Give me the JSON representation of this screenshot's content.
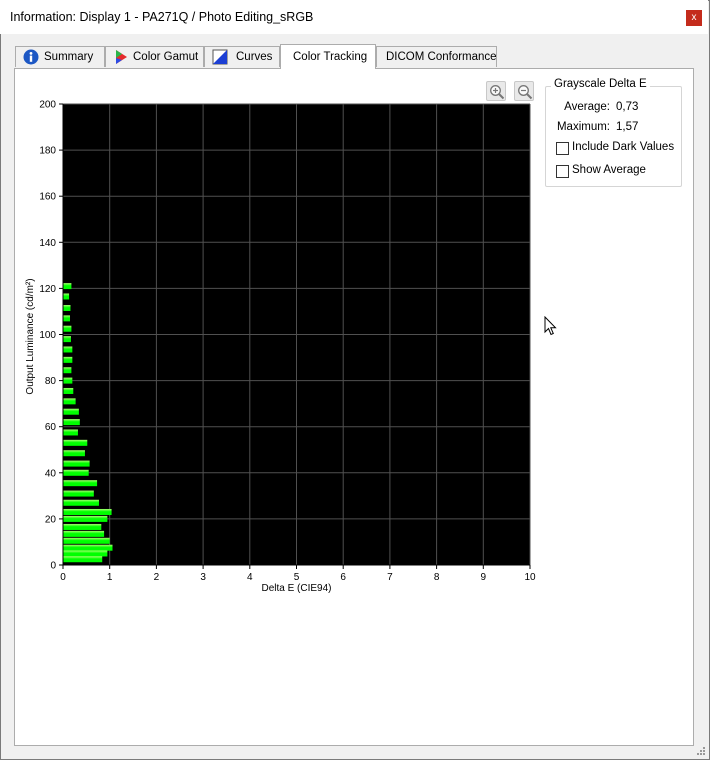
{
  "window": {
    "title": "Information: Display 1 - PA271Q / Photo Editing_sRGB",
    "close_label": "x"
  },
  "tabs": [
    {
      "label": "Summary",
      "icon": "info-icon",
      "active": false
    },
    {
      "label": "Color Gamut",
      "icon": "color-gamut-icon",
      "active": false
    },
    {
      "label": "Curves",
      "icon": "curves-icon",
      "active": false
    },
    {
      "label": "Color Tracking",
      "icon": "",
      "active": true
    },
    {
      "label": "DICOM Conformance",
      "icon": "",
      "active": false
    }
  ],
  "toolbar": {
    "zoom_in_icon": "zoom-in-icon",
    "zoom_out_icon": "zoom-out-icon"
  },
  "grayscale": {
    "title": "Grayscale Delta E",
    "average_label": "Average:",
    "average_value": "0,73",
    "maximum_label": "Maximum:",
    "maximum_value": "1,57",
    "include_dark_label": "Include Dark Values",
    "include_dark_checked": false,
    "show_average_label": "Show Average",
    "show_average_checked": false
  },
  "colors": {
    "plot_background": "#000000",
    "grid": "#505050",
    "bar_fill": "#00ff00",
    "bar_highlight": "#a8ff70",
    "close_button": "#c42b1c"
  },
  "chart_data": {
    "type": "bar",
    "orientation": "horizontal",
    "xlabel": "Delta E (CIE94)",
    "ylabel": "Output Luminance (cd/m²)",
    "xlim": [
      0,
      10
    ],
    "ylim": [
      0,
      200
    ],
    "xticks": [
      "0",
      "1",
      "2",
      "3",
      "4",
      "5",
      "6",
      "7",
      "8",
      "9",
      "10"
    ],
    "yticks": [
      "0",
      "20",
      "40",
      "60",
      "80",
      "100",
      "120",
      "140",
      "160",
      "180",
      "200"
    ],
    "grid": true,
    "bars": [
      {
        "y": 121,
        "value": 0.18
      },
      {
        "y": 116.5,
        "value": 0.13
      },
      {
        "y": 111.5,
        "value": 0.16
      },
      {
        "y": 107,
        "value": 0.15
      },
      {
        "y": 102.5,
        "value": 0.18
      },
      {
        "y": 98,
        "value": 0.17
      },
      {
        "y": 93.5,
        "value": 0.2
      },
      {
        "y": 89,
        "value": 0.2
      },
      {
        "y": 84.5,
        "value": 0.18
      },
      {
        "y": 80,
        "value": 0.2
      },
      {
        "y": 75.5,
        "value": 0.22
      },
      {
        "y": 71,
        "value": 0.27
      },
      {
        "y": 66.5,
        "value": 0.34
      },
      {
        "y": 62,
        "value": 0.36
      },
      {
        "y": 57.5,
        "value": 0.32
      },
      {
        "y": 53,
        "value": 0.52
      },
      {
        "y": 48.5,
        "value": 0.47
      },
      {
        "y": 44,
        "value": 0.57
      },
      {
        "y": 40,
        "value": 0.55
      },
      {
        "y": 35.5,
        "value": 0.73
      },
      {
        "y": 31,
        "value": 0.66
      },
      {
        "y": 27,
        "value": 0.77
      },
      {
        "y": 23,
        "value": 1.04
      },
      {
        "y": 20,
        "value": 0.95
      },
      {
        "y": 16.5,
        "value": 0.82
      },
      {
        "y": 13.5,
        "value": 0.88
      },
      {
        "y": 10.5,
        "value": 1.0
      },
      {
        "y": 7.5,
        "value": 1.06
      },
      {
        "y": 5,
        "value": 0.95
      },
      {
        "y": 2.5,
        "value": 0.84
      }
    ]
  }
}
